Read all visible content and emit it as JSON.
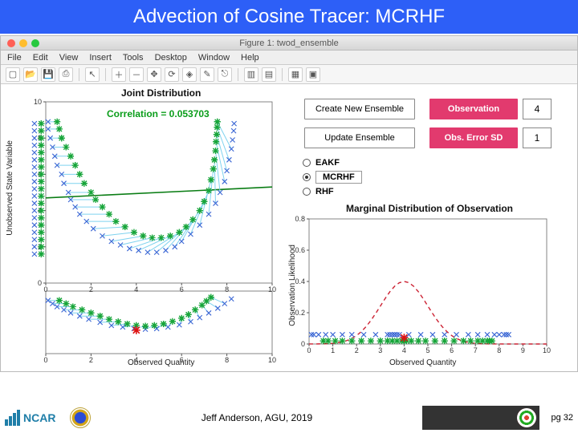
{
  "slide": {
    "title": "Advection of Cosine Tracer: MCRHF",
    "footer_credit": "Jeff Anderson, AGU, 2019",
    "page_label": "pg 32"
  },
  "window": {
    "title": "Figure 1: twod_ensemble",
    "menubar": [
      "File",
      "Edit",
      "View",
      "Insert",
      "Tools",
      "Desktop",
      "Window",
      "Help"
    ],
    "toolbar_icons": [
      "new-icon",
      "open-icon",
      "save-icon",
      "print-icon",
      "pointer-icon",
      "zoom-in-icon",
      "zoom-out-icon",
      "pan-icon",
      "rotate-icon",
      "data-cursor-icon",
      "brush-icon",
      "link-icon",
      "colorbar-icon",
      "legend-icon",
      "grid-icon",
      "subplot-icon"
    ]
  },
  "controls": {
    "create_label": "Create New Ensemble",
    "update_label": "Update Ensemble",
    "obs_label": "Observation",
    "obs_value": "4",
    "obs_sd_label": "Obs. Error SD",
    "obs_sd_value": "1",
    "filters": {
      "eakf": "EAKF",
      "mcrhf": "MCRHF",
      "rhf": "RHF",
      "selected": "mcrhf"
    }
  },
  "chart_data": [
    {
      "id": "joint",
      "type": "scatter",
      "title": "Joint Distribution",
      "xlabel": "Observed Quantity",
      "ylabel": "Unobserved State Variable",
      "xlim": [
        0,
        10
      ],
      "ylim": [
        0,
        10
      ],
      "correlation_label": "Correlation = 0.053703",
      "regression_line": {
        "y_at_x0": 4.7,
        "y_at_x10": 5.3
      },
      "series": [
        {
          "name": "prior",
          "marker": "x",
          "color": "#3a66d4",
          "points": [
            [
              0.1,
              8.9
            ],
            [
              0.1,
              8.5
            ],
            [
              0.2,
              8.0
            ],
            [
              0.3,
              7.5
            ],
            [
              0.4,
              7.0
            ],
            [
              0.5,
              6.5
            ],
            [
              0.7,
              6.0
            ],
            [
              0.8,
              5.5
            ],
            [
              1.0,
              5.0
            ],
            [
              1.1,
              4.6
            ],
            [
              1.3,
              4.2
            ],
            [
              1.5,
              3.8
            ],
            [
              1.8,
              3.4
            ],
            [
              2.1,
              3.0
            ],
            [
              2.5,
              2.6
            ],
            [
              2.9,
              2.3
            ],
            [
              3.3,
              2.1
            ],
            [
              3.7,
              1.9
            ],
            [
              4.1,
              1.8
            ],
            [
              4.5,
              1.7
            ],
            [
              4.9,
              1.7
            ],
            [
              5.3,
              1.8
            ],
            [
              5.7,
              2.0
            ],
            [
              6.0,
              2.3
            ],
            [
              6.4,
              2.7
            ],
            [
              6.8,
              3.2
            ],
            [
              7.2,
              3.8
            ],
            [
              7.5,
              4.4
            ],
            [
              7.7,
              5.0
            ],
            [
              7.9,
              5.6
            ],
            [
              8.0,
              6.2
            ],
            [
              8.1,
              6.8
            ],
            [
              8.2,
              7.4
            ],
            [
              8.25,
              7.9
            ],
            [
              8.3,
              8.4
            ],
            [
              8.32,
              8.8
            ]
          ]
        },
        {
          "name": "posterior",
          "marker": "*",
          "color": "#17a53a",
          "points": [
            [
              0.5,
              8.9
            ],
            [
              0.6,
              8.5
            ],
            [
              0.7,
              8.0
            ],
            [
              0.9,
              7.5
            ],
            [
              1.1,
              7.0
            ],
            [
              1.3,
              6.5
            ],
            [
              1.5,
              6.0
            ],
            [
              1.7,
              5.5
            ],
            [
              2.0,
              5.0
            ],
            [
              2.2,
              4.6
            ],
            [
              2.5,
              4.2
            ],
            [
              2.8,
              3.8
            ],
            [
              3.1,
              3.4
            ],
            [
              3.5,
              3.1
            ],
            [
              3.9,
              2.8
            ],
            [
              4.3,
              2.6
            ],
            [
              4.7,
              2.5
            ],
            [
              5.1,
              2.5
            ],
            [
              5.5,
              2.6
            ],
            [
              5.9,
              2.8
            ],
            [
              6.2,
              3.1
            ],
            [
              6.5,
              3.5
            ],
            [
              6.8,
              4.0
            ],
            [
              7.0,
              4.5
            ],
            [
              7.2,
              5.1
            ],
            [
              7.3,
              5.7
            ],
            [
              7.4,
              6.3
            ],
            [
              7.45,
              6.8
            ],
            [
              7.5,
              7.3
            ],
            [
              7.52,
              7.8
            ],
            [
              7.55,
              8.2
            ],
            [
              7.57,
              8.6
            ],
            [
              7.58,
              8.9
            ]
          ]
        },
        {
          "name": "unobs-prior",
          "marker": "x",
          "color": "#3a66d4",
          "points": [
            [
              -0.5,
              1.6
            ],
            [
              -0.5,
              2.0
            ],
            [
              -0.5,
              2.4
            ],
            [
              -0.5,
              2.8
            ],
            [
              -0.5,
              3.2
            ],
            [
              -0.5,
              3.6
            ],
            [
              -0.5,
              4.0
            ],
            [
              -0.5,
              4.4
            ],
            [
              -0.5,
              4.8
            ],
            [
              -0.5,
              5.2
            ],
            [
              -0.5,
              5.6
            ],
            [
              -0.5,
              6.0
            ],
            [
              -0.5,
              6.4
            ],
            [
              -0.5,
              6.8
            ],
            [
              -0.5,
              7.2
            ],
            [
              -0.5,
              7.6
            ],
            [
              -0.5,
              8.0
            ],
            [
              -0.5,
              8.4
            ],
            [
              -0.5,
              8.8
            ]
          ]
        },
        {
          "name": "unobs-posterior",
          "marker": "*",
          "color": "#17a53a",
          "points": [
            [
              -0.2,
              1.6
            ],
            [
              -0.2,
              2.0
            ],
            [
              -0.2,
              2.4
            ],
            [
              -0.2,
              2.8
            ],
            [
              -0.2,
              3.2
            ],
            [
              -0.2,
              3.6
            ],
            [
              -0.2,
              4.0
            ],
            [
              -0.2,
              4.4
            ],
            [
              -0.2,
              4.8
            ],
            [
              -0.2,
              5.2
            ],
            [
              -0.2,
              5.6
            ],
            [
              -0.2,
              6.0
            ],
            [
              -0.2,
              6.4
            ],
            [
              -0.2,
              6.8
            ],
            [
              -0.2,
              7.2
            ],
            [
              -0.2,
              7.6
            ],
            [
              -0.2,
              8.0
            ],
            [
              -0.2,
              8.4
            ],
            [
              -0.2,
              8.8
            ]
          ]
        }
      ],
      "xticks": [
        0,
        2,
        4,
        6,
        8,
        10
      ],
      "yticks": [
        0,
        2,
        4,
        6,
        8,
        10
      ]
    },
    {
      "id": "increments",
      "type": "scatter",
      "title": "",
      "xlabel": "Observed Quantity",
      "xlim": [
        0,
        10
      ],
      "ylim": [
        -1,
        1
      ],
      "obs_marker": {
        "x": 4,
        "color": "#d11"
      },
      "series": [
        {
          "name": "prior-1d",
          "marker": "x",
          "color": "#3a66d4",
          "points": [
            [
              0.1,
              0.7
            ],
            [
              0.3,
              0.6
            ],
            [
              0.5,
              0.5
            ],
            [
              0.8,
              0.4
            ],
            [
              1.1,
              0.3
            ],
            [
              1.5,
              0.2
            ],
            [
              1.9,
              0.1
            ],
            [
              2.4,
              0.0
            ],
            [
              2.9,
              -0.1
            ],
            [
              3.4,
              -0.15
            ],
            [
              3.9,
              -0.2
            ],
            [
              4.4,
              -0.22
            ],
            [
              4.9,
              -0.2
            ],
            [
              5.4,
              -0.15
            ],
            [
              5.9,
              -0.08
            ],
            [
              6.4,
              0.02
            ],
            [
              6.8,
              0.15
            ],
            [
              7.2,
              0.3
            ],
            [
              7.6,
              0.45
            ],
            [
              7.9,
              0.6
            ],
            [
              8.2,
              0.75
            ]
          ]
        },
        {
          "name": "posterior-1d",
          "marker": "*",
          "color": "#17a53a",
          "points": [
            [
              0.6,
              0.7
            ],
            [
              0.9,
              0.6
            ],
            [
              1.2,
              0.5
            ],
            [
              1.6,
              0.4
            ],
            [
              2.0,
              0.3
            ],
            [
              2.4,
              0.2
            ],
            [
              2.8,
              0.1
            ],
            [
              3.2,
              0.02
            ],
            [
              3.6,
              -0.05
            ],
            [
              4.0,
              -0.1
            ],
            [
              4.4,
              -0.12
            ],
            [
              4.8,
              -0.1
            ],
            [
              5.2,
              -0.05
            ],
            [
              5.6,
              0.03
            ],
            [
              6.0,
              0.13
            ],
            [
              6.3,
              0.25
            ],
            [
              6.6,
              0.4
            ],
            [
              6.9,
              0.55
            ],
            [
              7.1,
              0.68
            ],
            [
              7.3,
              0.8
            ]
          ]
        }
      ],
      "xticks": [
        0,
        2,
        4,
        6,
        8,
        10
      ]
    },
    {
      "id": "marginal",
      "type": "line",
      "title": "Marginal Distribution of Observation",
      "xlabel": "Observed Quantity",
      "ylabel": "Observation Likelihood",
      "xlim": [
        0,
        10
      ],
      "ylim": [
        0,
        0.8
      ],
      "xticks": [
        0,
        1,
        2,
        3,
        4,
        5,
        6,
        7,
        8,
        9,
        10
      ],
      "yticks": [
        0,
        0.2,
        0.4,
        0.6,
        0.8
      ],
      "likelihood_curve": {
        "style": "dashed",
        "color": "#c23",
        "mu": 4,
        "sigma": 1,
        "peak": 0.4
      },
      "obs_marker": {
        "x": 4,
        "color": "#d11"
      },
      "series": [
        {
          "name": "prior-1d",
          "marker": "x",
          "color": "#3a66d4",
          "values": [
            0.1,
            0.2,
            0.4,
            0.7,
            1.0,
            1.4,
            1.8,
            2.3,
            2.8,
            3.3,
            3.4,
            3.5,
            3.6,
            3.6,
            3.7,
            3.8,
            4.2,
            4.7,
            5.2,
            5.7,
            6.2,
            6.7,
            7.1,
            7.5,
            7.8,
            8.0,
            8.2,
            8.3,
            8.4
          ]
        },
        {
          "name": "posterior-1d",
          "marker": "*",
          "color": "#17a53a",
          "values": [
            0.6,
            0.8,
            1.1,
            1.4,
            1.8,
            2.2,
            2.6,
            3.0,
            3.3,
            3.5,
            3.7,
            3.9,
            4.0,
            4.1,
            4.3,
            4.6,
            4.9,
            5.3,
            5.7,
            6.1,
            6.5,
            6.8,
            7.1,
            7.3,
            7.5,
            7.6,
            7.7
          ]
        }
      ]
    }
  ]
}
